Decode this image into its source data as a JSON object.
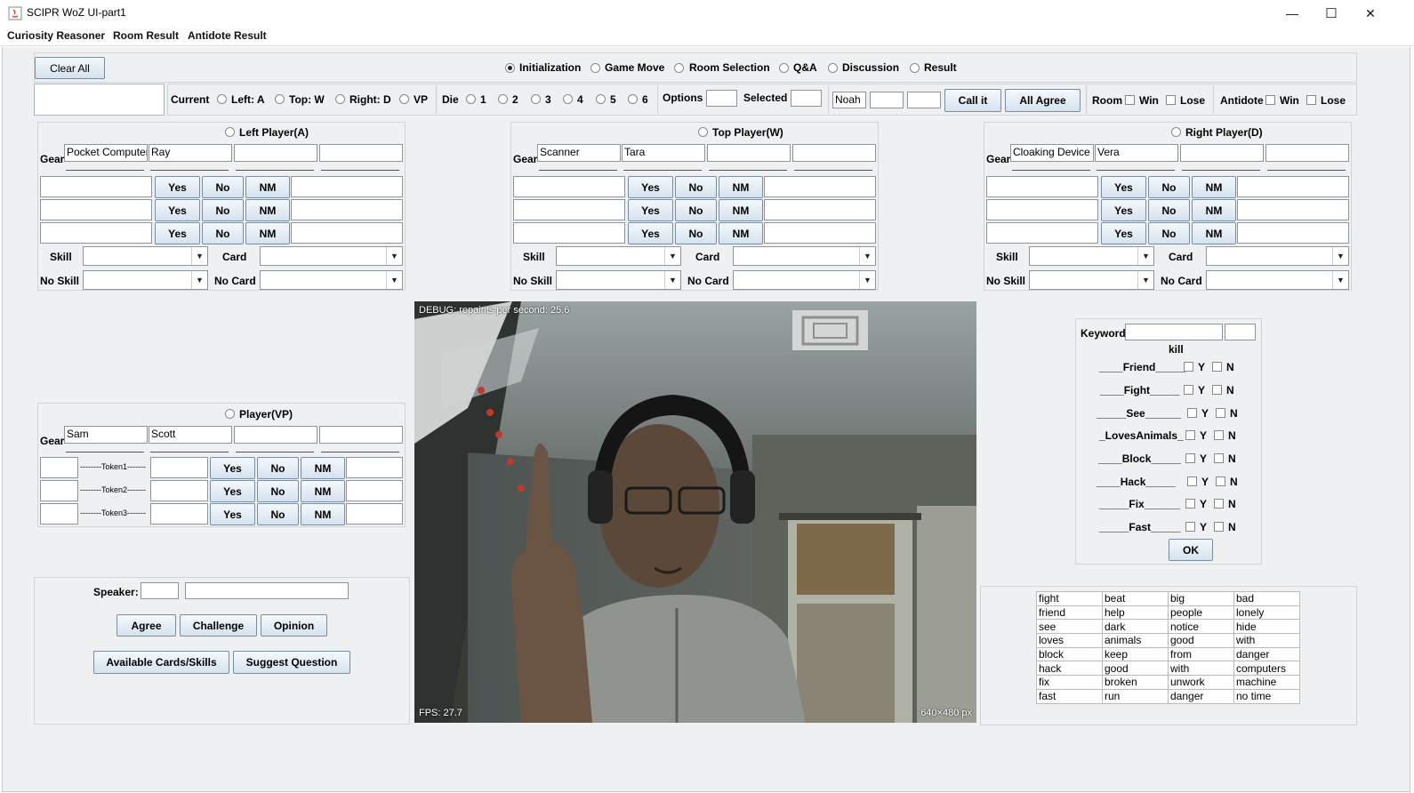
{
  "window": {
    "title": "SCIPR WoZ UI-part1",
    "minimize": "—",
    "maximize": "☐",
    "close": "✕"
  },
  "menu": [
    "Curiosity Reasoner",
    "Room Result",
    "Antidote Result"
  ],
  "top": {
    "clear_all": "Clear All",
    "modes": [
      "Initialization",
      "Game Move",
      "Room Selection",
      "Q&A",
      "Discussion",
      "Result"
    ],
    "selected_mode": "Initialization"
  },
  "control_row": {
    "current_label": "Current",
    "current_options": [
      "Left: A",
      "Top: W",
      "Right: D",
      "VP"
    ],
    "die_label": "Die",
    "die_options": [
      "1",
      "2",
      "3",
      "4",
      "5",
      "6"
    ],
    "options_label": "Options",
    "selected_label": "Selected",
    "name_value": "Noah",
    "call_it": "Call it",
    "all_agree": "All Agree",
    "room_label": "Room",
    "win": "Win",
    "lose": "Lose",
    "antidote_label": "Antidote"
  },
  "players": [
    {
      "title": "Left Player(A)",
      "gear": [
        "Pocket Computer",
        "Ray",
        "",
        ""
      ]
    },
    {
      "title": "Top Player(W)",
      "gear": [
        "Scanner",
        "Tara",
        "",
        ""
      ]
    },
    {
      "title": "Right Player(D)",
      "gear": [
        "Cloaking Device",
        "Vera",
        "",
        ""
      ]
    }
  ],
  "labels": {
    "gear": "Gear",
    "yes": "Yes",
    "no": "No",
    "nm": "NM",
    "skill": "Skill",
    "card": "Card",
    "no_skill": "No Skill",
    "no_card": "No Card"
  },
  "vp": {
    "title": "Player(VP)",
    "gear": [
      "Sam",
      "Scott",
      "",
      ""
    ],
    "tokens": [
      "--------Token1-------",
      "--------Token2-------",
      "--------Token3-------"
    ]
  },
  "speaker": {
    "label": "Speaker:",
    "agree": "Agree",
    "challenge": "Challenge",
    "opinion": "Opinion",
    "available": "Available Cards/Skills",
    "suggest": "Suggest Question"
  },
  "video": {
    "debug": "DEBUG: repaints per second: 25.6",
    "fps": "FPS: 27.7",
    "size": "640×480 px"
  },
  "keywords": {
    "label": "Keyword",
    "current": "kill",
    "items": [
      "____Friend_____",
      "____Fight_____",
      "_____See______",
      "_LovesAnimals_",
      "____Block_____",
      "____Hack_____",
      "_____Fix______",
      "_____Fast_____"
    ],
    "y": "Y",
    "n": "N",
    "ok": "OK"
  },
  "word_table": [
    [
      "fight",
      "beat",
      "big",
      "bad"
    ],
    [
      "friend",
      "help",
      "people",
      "lonely"
    ],
    [
      "see",
      "dark",
      "notice",
      "hide"
    ],
    [
      "loves",
      "animals",
      "good",
      "with"
    ],
    [
      "block",
      "keep",
      "from",
      "danger"
    ],
    [
      "hack",
      "good",
      "with",
      "computers"
    ],
    [
      "fix",
      "broken",
      "unwork",
      "machine"
    ],
    [
      "fast",
      "run",
      "danger",
      "no time"
    ]
  ]
}
